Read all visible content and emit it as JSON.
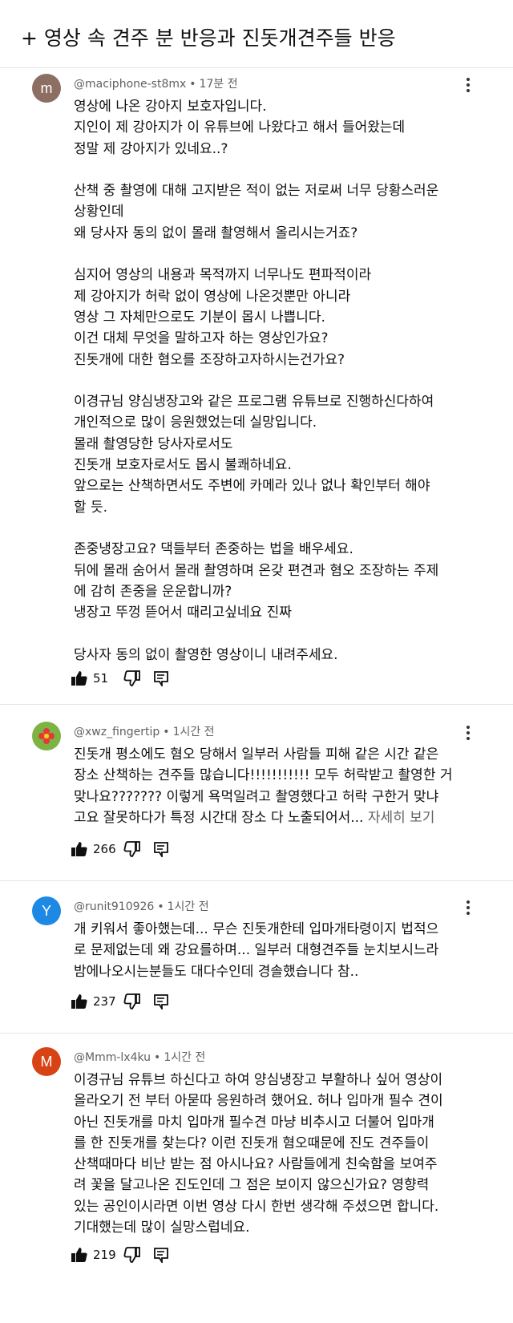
{
  "page": {
    "title": "+ 영상 속 견주 분 반응과 진돗개견주들 반응",
    "more_label": "자세히 보기"
  },
  "comments": [
    {
      "author": "@maciphone-st8mx",
      "time": "17분 전",
      "avatar_letter": "m",
      "avatar_color": "#8d6e63",
      "likes": "51",
      "lines": [
        "영상에 나온 강아지 보호자입니다.",
        "지인이 제 강아지가 이 유튜브에 나왔다고 해서 들어왔는데",
        "정말 제 강아지가 있네요..?",
        "",
        "산책 중 촬영에 대해 고지받은 적이 없는 저로써 너무 당황스러운",
        "상황인데",
        "왜 당사자 동의 없이 몰래 촬영해서 올리시는거죠?",
        "",
        "심지어 영상의 내용과 목적까지 너무나도 편파적이라",
        "제 강아지가 허락 없이 영상에 나온것뿐만 아니라",
        "영상 그 자체만으로도 기분이 몹시 나쁩니다.",
        "이건 대체 무엇을 말하고자 하는 영상인가요?",
        "진돗개에 대한 혐오를 조장하고자하시는건가요?",
        "",
        "이경규님 양심냉장고와 같은 프로그램 유튜브로 진행하신다하여",
        "개인적으로 많이 응원했었는데 실망입니다.",
        "몰래 촬영당한 당사자로서도",
        "진돗개 보호자로서도 몹시 불쾌하네요.",
        "앞으로는 산책하면서도 주변에 카메라 있나 없나 확인부터 해야",
        "할 듯.",
        "",
        "존중냉장고요? 댁들부터 존중하는 법을 배우세요.",
        "뒤에 몰래 숨어서 몰래 촬영하며 온갖 편견과 혐오 조장하는 주제",
        "에 감히 존중을 운운합니까?",
        "냉장고 뚜껑 뜯어서 때리고싶네요 진짜",
        "",
        "당사자 동의 없이 촬영한 영상이니 내려주세요."
      ]
    },
    {
      "author": "@xwz_fingertip",
      "time": "1시간 전",
      "avatar_letter": "",
      "avatar_color": "#7cb342",
      "likes": "266",
      "lines": [
        "진돗개 평소에도 혐오 당해서 일부러 사람들 피해 같은 시간 같은",
        "장소 산책하는 견주들 많습니다!!!!!!!!!!! 모두 허락받고 촬영한 거",
        "맞나요??????? 이렇게 욕먹일려고 촬영했다고 허락 구한거 맞냐",
        "고요 잘못하다가 특정 시간대 장소 다 노출되어서... "
      ]
    },
    {
      "author": "@runit910926",
      "time": "1시간 전",
      "avatar_letter": "Y",
      "avatar_color": "#1e88e5",
      "likes": "237",
      "lines": [
        "개 키워서 좋아했는데... 무슨 진돗개한테 입마개타령이지 법적으",
        "로 문제없는데 왜 강요를하며... 일부러 대형견주들 눈치보시느라",
        "밤에나오시는분들도 대다수인데 경솔했습니다 참.."
      ]
    },
    {
      "author": "@Mmm-lx4ku",
      "time": "1시간 전",
      "avatar_letter": "M",
      "avatar_color": "#d84315",
      "likes": "219",
      "lines": [
        "이경규님 유튜브 하신다고 하여 양심냉장고 부활하나 싶어 영상이",
        "올라오기 전 부터 아묻따 응원하려 했어요. 허나 입마개 필수 견이",
        "아닌 진돗개를 마치 입마개 필수견 마냥 비추시고 더불어 입마개",
        "를 한 진돗개를 찾는다? 이런 진돗개 혐오때문에 진도 견주들이",
        "산책때마다 비난 받는 점 아시나요? 사람들에게 친숙함을 보여주",
        "려 꽃을 달고나온 진도인데 그 점은 보이지 않으신가요? 영향력",
        "있는 공인이시라면 이번 영상 다시 한번 생각해 주셨으면 합니다.",
        "기대했는데 많이 실망스럽네요."
      ]
    }
  ]
}
